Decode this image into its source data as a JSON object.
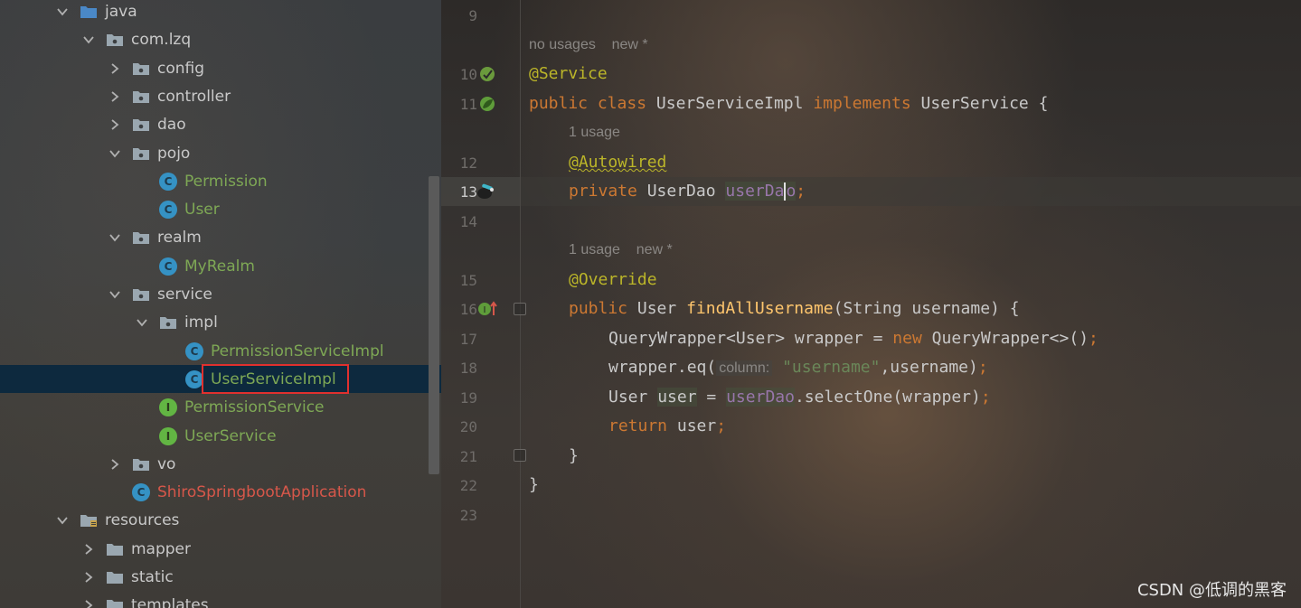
{
  "project_tree": {
    "items": [
      {
        "label": "java",
        "kind": "folder-src",
        "depth": 0,
        "expanded": true
      },
      {
        "label": "com.lzq",
        "kind": "package",
        "depth": 1,
        "expanded": true
      },
      {
        "label": "config",
        "kind": "package",
        "depth": 2,
        "expanded": false
      },
      {
        "label": "controller",
        "kind": "package",
        "depth": 2,
        "expanded": false
      },
      {
        "label": "dao",
        "kind": "package",
        "depth": 2,
        "expanded": false
      },
      {
        "label": "pojo",
        "kind": "package",
        "depth": 2,
        "expanded": true
      },
      {
        "label": "Permission",
        "kind": "class",
        "depth": 3
      },
      {
        "label": "User",
        "kind": "class",
        "depth": 3
      },
      {
        "label": "realm",
        "kind": "package",
        "depth": 2,
        "expanded": true
      },
      {
        "label": "MyRealm",
        "kind": "class",
        "depth": 3
      },
      {
        "label": "service",
        "kind": "package",
        "depth": 2,
        "expanded": true
      },
      {
        "label": "impl",
        "kind": "package",
        "depth": 3,
        "expanded": true
      },
      {
        "label": "PermissionServiceImpl",
        "kind": "class",
        "depth": 4
      },
      {
        "label": "UserServiceImpl",
        "kind": "class",
        "depth": 4,
        "selected": true
      },
      {
        "label": "PermissionService",
        "kind": "interface",
        "depth": 3
      },
      {
        "label": "UserService",
        "kind": "interface",
        "depth": 3
      },
      {
        "label": "vo",
        "kind": "package",
        "depth": 2,
        "expanded": false
      },
      {
        "label": "ShiroSpringbootApplication",
        "kind": "app-class",
        "depth": 2
      },
      {
        "label": "resources",
        "kind": "folder-res",
        "depth": 0,
        "expanded": true
      },
      {
        "label": "mapper",
        "kind": "folder",
        "depth": 1,
        "expanded": false
      },
      {
        "label": "static",
        "kind": "folder",
        "depth": 1,
        "expanded": false
      },
      {
        "label": "templates",
        "kind": "folder",
        "depth": 1,
        "expanded": false
      }
    ]
  },
  "editor": {
    "line_numbers": [
      "9",
      "10",
      "11",
      "12",
      "13",
      "14",
      "15",
      "16",
      "17",
      "18",
      "19",
      "20",
      "21",
      "22",
      "23"
    ],
    "current_line": "13",
    "hints": {
      "h1_a": "no usages",
      "h1_b": "new *",
      "h2": "1 usage",
      "h3_a": "1 usage",
      "h3_b": "new *"
    },
    "code": {
      "l10_ann": "@Service",
      "l11_public": "public",
      "l11_class": "class",
      "l11_name": "UserServiceImpl",
      "l11_impl": "implements",
      "l11_iface": "UserService {",
      "l12_ann": "@Autowired",
      "l13_private": "private",
      "l13_type": "UserDao",
      "l13_field_a": "userDa",
      "l13_field_b": "o",
      "l13_semi": ";",
      "l15_ann": "@Override",
      "l16_public": "public",
      "l16_type": "User",
      "l16_method": "findAllUsername",
      "l16_params": "(String username) {",
      "l17_type": "QueryWrapper<User> wrapper =",
      "l17_new": "new",
      "l17_rest": "QueryWrapper<>()",
      "l17_semi": ";",
      "l18_call": "wrapper.eq(",
      "l18_hint": "column:",
      "l18_str": "\"username\"",
      "l18_rest": ",username)",
      "l18_semi": ";",
      "l19_type": "User",
      "l19_var": "user",
      "l19_eq": "=",
      "l19_field": "userDao",
      "l19_rest": ".selectOne(wrapper)",
      "l19_semi": ";",
      "l20_return": "return",
      "l20_rest": "user",
      "l20_semi": ";",
      "l21_brace": "}",
      "l22_brace": "}"
    }
  },
  "watermark": "CSDN @低调的黑客",
  "colors": {
    "keyword": "#cc7832",
    "annotation": "#bbb529",
    "field": "#9876aa",
    "method": "#ffc66d",
    "string": "#6a8759",
    "tree_class": "#7ea855",
    "tree_app": "#d6574a",
    "selection": "#0d293e",
    "highlight_box": "#e0302e"
  }
}
